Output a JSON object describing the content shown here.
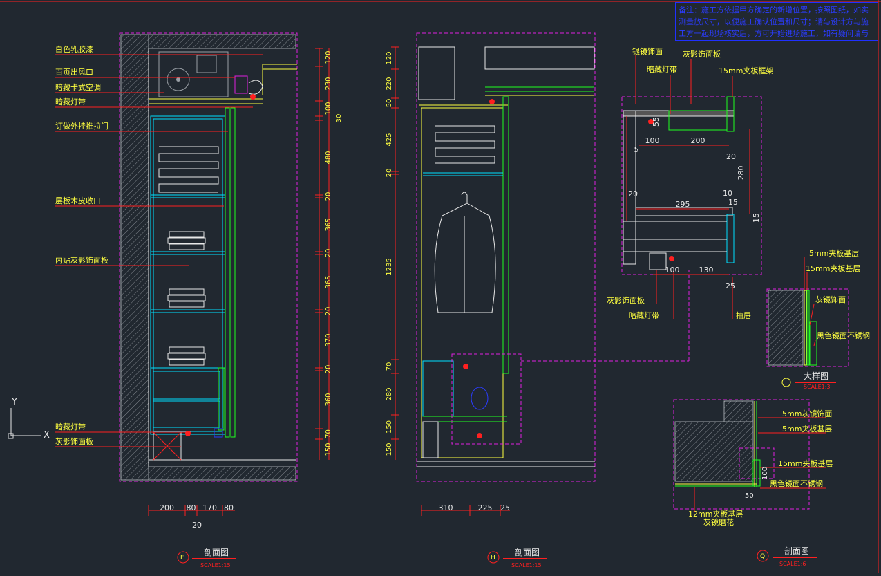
{
  "note": "备注：施工方依据甲方确定的新增位置，按照图纸，如实测量放尺寸，以便施工确认位置和尺寸；请与设计方与施工方一起现场核实后，方可开始进场施工，如有疑问请与设计方联系并及时沟通。",
  "colors": {
    "bg": "#212830",
    "red": "#ff2020",
    "yellow": "#ffff40",
    "cyan": "#00e0ff",
    "green": "#20ff20",
    "magenta": "#e020e0",
    "white": "#e8e8e8"
  },
  "section_e": {
    "labels": [
      "白色乳胶漆",
      "百页出风口",
      "暗藏卡式空调",
      "暗藏灯带",
      "订做外挂推拉门",
      "层板木皮收口",
      "内贴灰影饰面板",
      "暗藏灯带",
      "灰影饰面板"
    ],
    "vdims": [
      "120",
      "230",
      "100",
      "30",
      "480",
      "20",
      "365",
      "20",
      "365",
      "20",
      "370",
      "20",
      "360",
      "70",
      "150"
    ],
    "hdims": [
      "200",
      "80",
      "170",
      "80"
    ],
    "hdim_total": "20",
    "title": "剖面图",
    "scale": "SCALE1:15",
    "tag": "E"
  },
  "section_h": {
    "vdims": [
      "120",
      "220",
      "50",
      "425",
      "20",
      "1235",
      "70",
      "280",
      "150",
      "150"
    ],
    "hdims": [
      "310",
      "225",
      "25"
    ],
    "title": "剖面图",
    "scale": "SCALE1:15",
    "tag": "H"
  },
  "detail_top": {
    "labels": [
      "银镜饰面",
      "灰影饰面板",
      "暗藏灯带",
      "15mm夹板框架",
      "灰影饰面板",
      "暗藏灯带",
      "抽屉"
    ],
    "dims": [
      "55",
      "100",
      "200",
      "5",
      "20",
      "280",
      "20",
      "10",
      "295",
      "15",
      "15",
      "100",
      "130",
      "25"
    ]
  },
  "detail_large": {
    "labels": [
      "5mm夹板基层",
      "15mm夹板基层",
      "灰镜饰面",
      "黑色镜面不锈钢"
    ],
    "title": "大样图",
    "scale": "SCALE1:3"
  },
  "section_q": {
    "labels": [
      "5mm灰镜饰面",
      "5mm夹板基层",
      "15mm夹板基层",
      "黑色镜面不锈钢",
      "12mm夹板基层",
      "灰镜磨花"
    ],
    "dims": [
      "100",
      "50"
    ],
    "title": "剖面图",
    "scale": "SCALE1:6",
    "tag": "Q"
  },
  "ucs": {
    "y": "Y",
    "x": "X"
  }
}
